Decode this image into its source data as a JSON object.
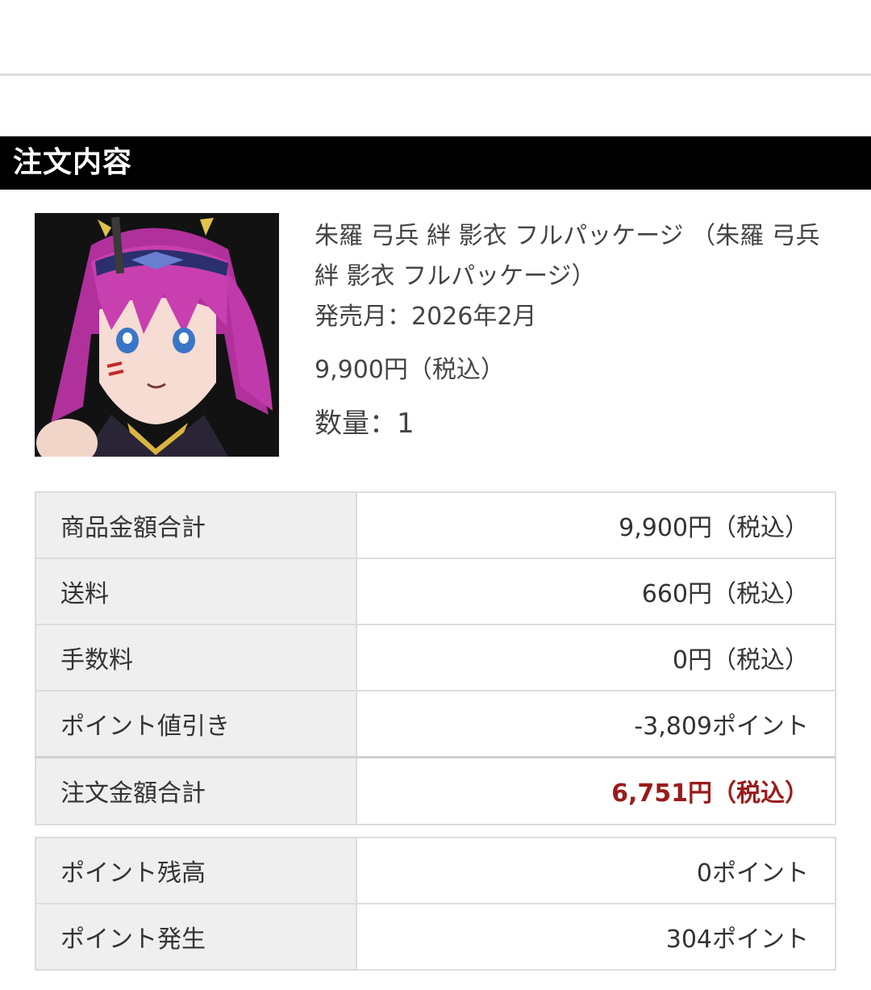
{
  "section": {
    "title": "注文内容"
  },
  "product": {
    "name": "朱羅 弓兵 絆 影衣 フルパッケージ （朱羅 弓兵 絆 影衣 フルパッケージ）",
    "release": "発売月：2026年2月",
    "price": "9,900円（税込）",
    "quantity": "数量：1"
  },
  "summary": [
    {
      "label": "商品金額合計",
      "value": "9,900円（税込）"
    },
    {
      "label": "送料",
      "value": "660円（税込）"
    },
    {
      "label": "手数料",
      "value": "0円（税込）"
    },
    {
      "label": "ポイント値引き",
      "value": "-3,809ポイント"
    },
    {
      "label": "注文金額合計",
      "value": "6,751円（税込）"
    }
  ],
  "points": [
    {
      "label": "ポイント残高",
      "value": "0ポイント"
    },
    {
      "label": "ポイント発生",
      "value": "304ポイント"
    }
  ],
  "colors": {
    "total_value": "#9b1b1b",
    "header_bg": "#000000"
  }
}
